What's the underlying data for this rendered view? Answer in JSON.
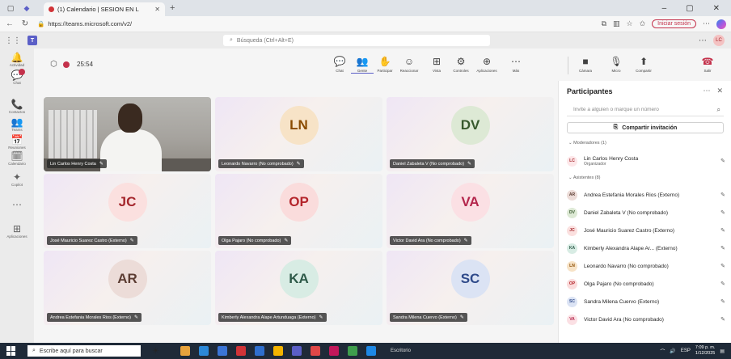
{
  "browser": {
    "tab_title": "(1) Calendario | SESION EN L",
    "url": "https://teams.microsoft.com/v2/",
    "signin_label": "Iniciar sesión"
  },
  "teams": {
    "search_placeholder": "Búsqueda (Ctrl+Alt+E)",
    "user_initials": "LC"
  },
  "rail": [
    {
      "label": "Actividad",
      "icon": "bell-icon",
      "glyph": "🔔"
    },
    {
      "label": "Chat",
      "icon": "chat-icon",
      "glyph": "💬"
    },
    {
      "label": "Contactos",
      "icon": "contacts-icon",
      "glyph": "📞"
    },
    {
      "label": "Teams",
      "icon": "teams-icon",
      "glyph": "👥"
    },
    {
      "label": "Reuniones",
      "icon": "meetings-icon",
      "glyph": "📅"
    },
    {
      "label": "Calendario",
      "icon": "calendar-icon",
      "glyph": "🗓"
    },
    {
      "label": "Copilot",
      "icon": "copilot-icon",
      "glyph": "✦"
    },
    {
      "label": "",
      "icon": "more-icon",
      "glyph": "⋯"
    },
    {
      "label": "Aplicaciones",
      "icon": "apps-icon",
      "glyph": "⊞"
    }
  ],
  "meeting": {
    "timer": "25:54",
    "tools": [
      {
        "label": "Chat",
        "glyph": "💬",
        "icon": "chat-icon"
      },
      {
        "label": "Gente",
        "glyph": "👥",
        "icon": "people-icon"
      },
      {
        "label": "Participar",
        "glyph": "✋",
        "icon": "raise-hand-icon"
      },
      {
        "label": "Reaccionar",
        "glyph": "☺",
        "icon": "react-icon"
      },
      {
        "label": "Vista",
        "glyph": "⊞",
        "icon": "view-icon"
      },
      {
        "label": "Controles",
        "glyph": "⚙",
        "icon": "controls-icon"
      },
      {
        "label": "Aplicaciones",
        "glyph": "⊕",
        "icon": "apps-icon"
      },
      {
        "label": "Más",
        "glyph": "⋯",
        "icon": "more-icon"
      },
      {
        "label": "Cámara",
        "glyph": "■",
        "icon": "camera-icon"
      },
      {
        "label": "Micro",
        "glyph": "🎙",
        "icon": "mic-icon"
      },
      {
        "label": "Compartir",
        "glyph": "⬆",
        "icon": "share-icon"
      }
    ],
    "leave_label": "Salir"
  },
  "tiles": [
    {
      "name": "Lin Carlos Henry Costa",
      "initials": "",
      "video": true,
      "bg": "#fde7e9",
      "fg": "#a4262c"
    },
    {
      "name": "Leonardo Navarro (No comprobado)",
      "initials": "LN",
      "video": false,
      "bg": "#f7e3c7",
      "fg": "#8a4b00"
    },
    {
      "name": "Daniel Zabaleta V (No comprobado)",
      "initials": "DV",
      "video": false,
      "bg": "#dde9d5",
      "fg": "#37592d"
    },
    {
      "name": "José Mauricio Suarez Castro (Externo)",
      "initials": "JC",
      "video": false,
      "bg": "#fbe0df",
      "fg": "#a4262c"
    },
    {
      "name": "Olga Pajaro (No comprobado)",
      "initials": "OP",
      "video": false,
      "bg": "#fadcdc",
      "fg": "#b4262c"
    },
    {
      "name": "Victor David Ara (No comprobado)",
      "initials": "VA",
      "video": false,
      "bg": "#fbe0e4",
      "fg": "#b4264c"
    },
    {
      "name": "Andrea Estefania Morales Rios (Externo)",
      "initials": "AR",
      "video": false,
      "bg": "#ecdcd8",
      "fg": "#5c3d33"
    },
    {
      "name": "Kimberly Alexandra Alape Artunduaga (Externo)",
      "initials": "KA",
      "video": false,
      "bg": "#d8ece4",
      "fg": "#2d5948"
    },
    {
      "name": "Sandra Milena Cuervo (Externo)",
      "initials": "SC",
      "video": false,
      "bg": "#dbe3f4",
      "fg": "#2f4a8a"
    }
  ],
  "panel": {
    "title": "Participantes",
    "invite_placeholder": "Invite a alguien o marque un número",
    "share_label": "Compartir invitación",
    "moderators_label": "Moderadores (1)",
    "attendees_label": "Asistentes (8)",
    "moderators": [
      {
        "initials": "LC",
        "name": "Lin Carlos Henry Costa",
        "role": "Organizador",
        "bg": "#fde7e9",
        "fg": "#a4262c"
      }
    ],
    "attendees": [
      {
        "initials": "AR",
        "name": "Andrea Estefania Morales Rios (Externo)",
        "bg": "#ecdcd8",
        "fg": "#5c3d33"
      },
      {
        "initials": "DV",
        "name": "Daniel Zabaleta V (No comprobado)",
        "bg": "#dde9d5",
        "fg": "#37592d"
      },
      {
        "initials": "JC",
        "name": "José Mauricio Suarez Castro (Externo)",
        "bg": "#fbe0df",
        "fg": "#a4262c"
      },
      {
        "initials": "KA",
        "name": "Kimberly Alexandra Alape Ar... (Externo)",
        "bg": "#d8ece4",
        "fg": "#2d5948"
      },
      {
        "initials": "LN",
        "name": "Leonardo Navarro (No comprobado)",
        "bg": "#f7e3c7",
        "fg": "#8a4b00"
      },
      {
        "initials": "OP",
        "name": "Olga Pajaro (No comprobado)",
        "bg": "#fadcdc",
        "fg": "#b4262c"
      },
      {
        "initials": "SC",
        "name": "Sandra Milena Cuervo (Externo)",
        "bg": "#dbe3f4",
        "fg": "#2f4a8a"
      },
      {
        "initials": "VA",
        "name": "Victor David Ara (No comprobado)",
        "bg": "#fbe0e4",
        "fg": "#b4264c"
      }
    ]
  },
  "taskbar": {
    "search_placeholder": "Escribe aquí para buscar",
    "desktop_label": "Escritorio",
    "lang": "ESP",
    "time": "7:09 p. m.",
    "date": "1/12/2025"
  }
}
